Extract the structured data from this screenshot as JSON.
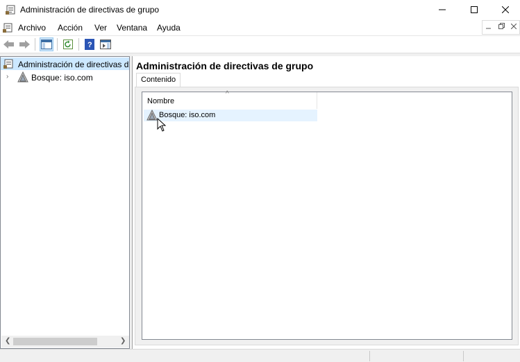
{
  "window": {
    "title": "Administración de directivas de grupo",
    "controls": [
      "minimize-icon",
      "maximize-icon",
      "close-icon"
    ]
  },
  "menubar": {
    "items": [
      "Archivo",
      "Acción",
      "Ver",
      "Ventana",
      "Ayuda"
    ],
    "mdi_controls": [
      "minimize-icon",
      "restore-icon",
      "close-icon"
    ]
  },
  "toolbar": {
    "buttons": [
      "back-arrow-icon",
      "forward-arrow-icon",
      "show-hide-console-tree-icon",
      "refresh-icon",
      "help-icon",
      "action-pane-icon"
    ]
  },
  "tree": {
    "root_label": "Administración de directivas d",
    "child_label": "Bosque: iso.com"
  },
  "details": {
    "title": "Administración de directivas de grupo",
    "tab_label": "Contenido",
    "column_header": "Nombre",
    "rows": [
      {
        "label": "Bosque: iso.com",
        "icon": "forest-icon"
      }
    ]
  },
  "colors": {
    "selection": "#cce8ff",
    "row_hover": "#e5f3ff",
    "accent": "#0078d7"
  }
}
